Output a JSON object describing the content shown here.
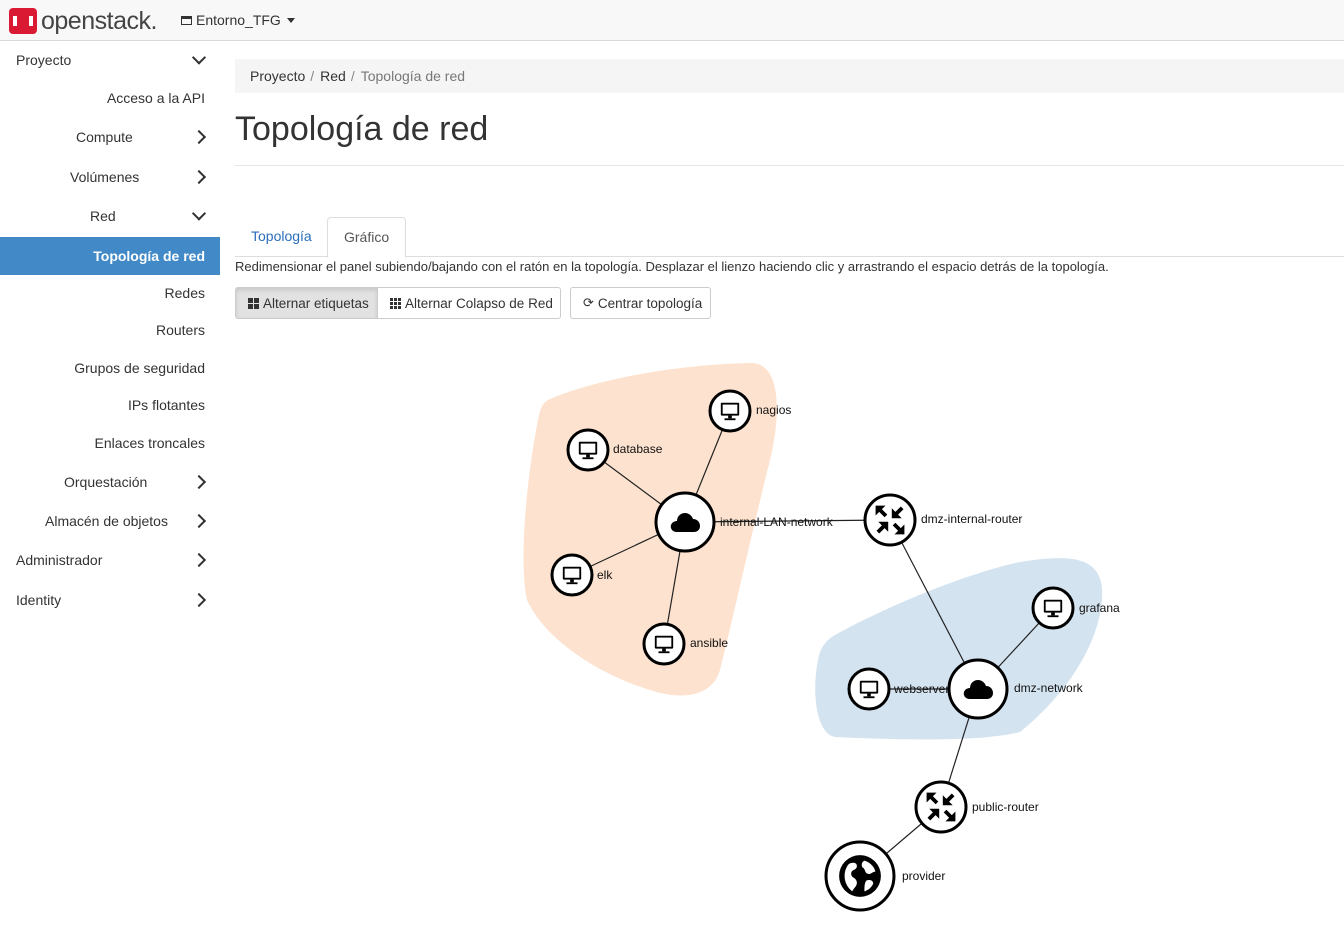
{
  "header": {
    "brand_prefix": "open",
    "brand_suffix": "stack.",
    "project_name": "Entorno_TFG"
  },
  "sidebar": {
    "items": [
      {
        "label": "Proyecto"
      },
      {
        "label": "Acceso a la API"
      },
      {
        "label": "Compute"
      },
      {
        "label": "Volúmenes"
      },
      {
        "label": "Red"
      },
      {
        "label": "Topología de red"
      },
      {
        "label": "Redes"
      },
      {
        "label": "Routers"
      },
      {
        "label": "Grupos de seguridad"
      },
      {
        "label": "IPs flotantes"
      },
      {
        "label": "Enlaces troncales"
      },
      {
        "label": "Orquestación"
      },
      {
        "label": "Almacén de objetos"
      },
      {
        "label": "Administrador"
      },
      {
        "label": "Identity"
      }
    ]
  },
  "breadcrumb": [
    "Proyecto",
    "Red",
    "Topología de red"
  ],
  "page": {
    "title": "Topología de red",
    "help_text": "Redimensionar el panel subiendo/bajando con el ratón en la topología. Desplazar el lienzo haciendo clic y arrastrando el espacio detrás de la topología."
  },
  "tabs": [
    {
      "label": "Topología",
      "active": false
    },
    {
      "label": "Gráfico",
      "active": true
    }
  ],
  "buttons": {
    "toggle_labels": "Alternar etiquetas",
    "toggle_collapse": "Alternar Colapso de Red",
    "center": "Centrar topología"
  },
  "topology": {
    "network_colors": {
      "internal-LAN-network": "#fde3cf",
      "dmz-network": "#d4e3f0"
    },
    "nodes": [
      {
        "id": "nagios",
        "type": "instance",
        "label": "nagios"
      },
      {
        "id": "database",
        "type": "instance",
        "label": "database"
      },
      {
        "id": "internal-LAN-network",
        "type": "network",
        "label": "internal-LAN-network"
      },
      {
        "id": "elk",
        "type": "instance",
        "label": "elk"
      },
      {
        "id": "ansible",
        "type": "instance",
        "label": "ansible"
      },
      {
        "id": "dmz-internal-router",
        "type": "router",
        "label": "dmz-internal-router"
      },
      {
        "id": "grafana",
        "type": "instance",
        "label": "grafana"
      },
      {
        "id": "webserver",
        "type": "instance",
        "label": "webserver"
      },
      {
        "id": "dmz-network",
        "type": "network",
        "label": "dmz-network"
      },
      {
        "id": "public-router",
        "type": "router",
        "label": "public-router"
      },
      {
        "id": "provider",
        "type": "external",
        "label": "provider"
      }
    ],
    "links": [
      [
        "nagios",
        "internal-LAN-network"
      ],
      [
        "database",
        "internal-LAN-network"
      ],
      [
        "elk",
        "internal-LAN-network"
      ],
      [
        "ansible",
        "internal-LAN-network"
      ],
      [
        "internal-LAN-network",
        "dmz-internal-router"
      ],
      [
        "dmz-internal-router",
        "dmz-network"
      ],
      [
        "grafana",
        "dmz-network"
      ],
      [
        "webserver",
        "dmz-network"
      ],
      [
        "dmz-network",
        "public-router"
      ],
      [
        "public-router",
        "provider"
      ]
    ]
  }
}
